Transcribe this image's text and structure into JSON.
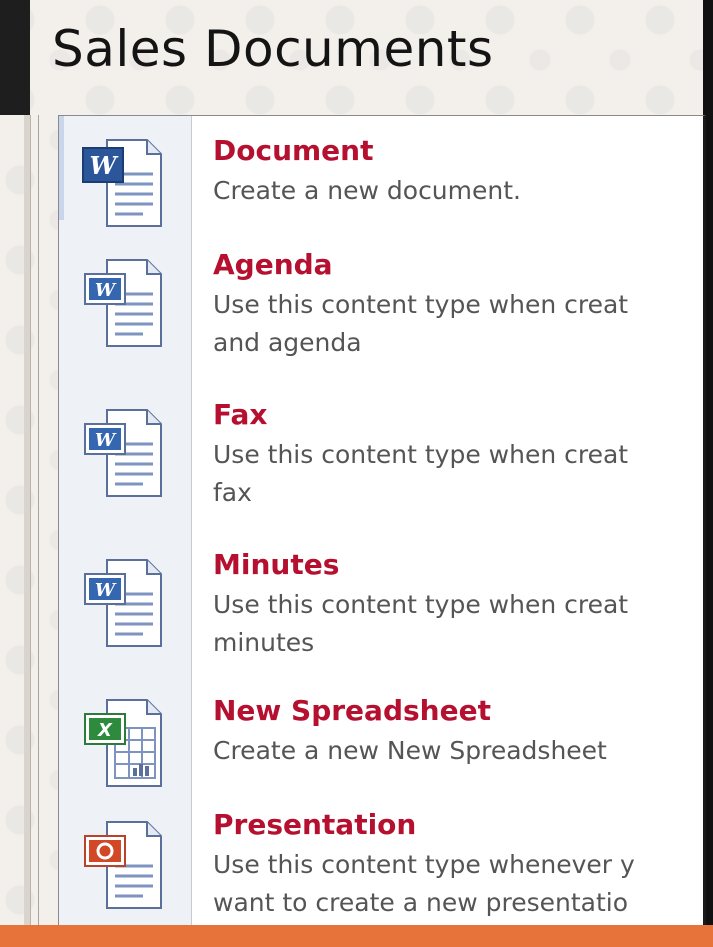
{
  "title": "Sales Documents",
  "menu": {
    "items": [
      {
        "title": "Document",
        "line1": "Create a new document.",
        "line2": "",
        "icon": "word-document-icon"
      },
      {
        "title": "Agenda",
        "line1": "Use this content type when creat",
        "line2": "and agenda",
        "icon": "word-template-icon"
      },
      {
        "title": "Fax",
        "line1": "Use this content type when creat",
        "line2": "fax",
        "icon": "word-template-icon"
      },
      {
        "title": "Minutes",
        "line1": "Use this content type when creat",
        "line2": "minutes",
        "icon": "word-template-icon"
      },
      {
        "title": "New Spreadsheet",
        "line1": "Create a new New Spreadsheet",
        "line2": "",
        "icon": "excel-spreadsheet-icon"
      },
      {
        "title": "Presentation",
        "line1": "Use this content type whenever y",
        "line2": "want to create a new presentatio",
        "icon": "powerpoint-presentation-icon"
      }
    ]
  },
  "colors": {
    "item_title": "#b5102f",
    "item_desc": "#555555",
    "accent_strip": "#e8733a"
  }
}
